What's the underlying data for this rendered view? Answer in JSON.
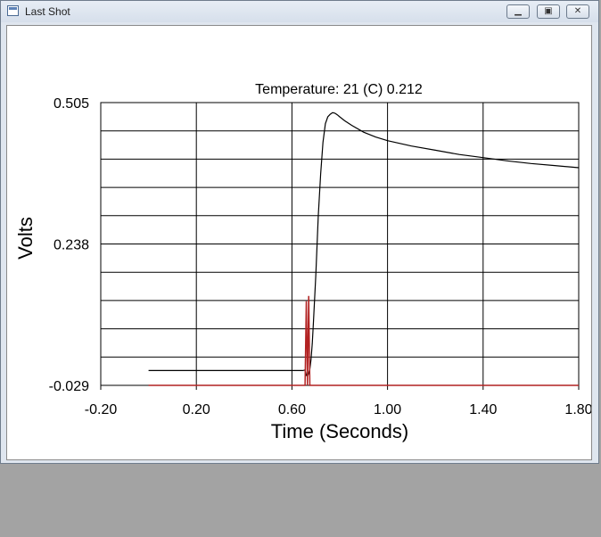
{
  "window": {
    "title": "Last Shot",
    "icon": "app-window-icon",
    "buttons": [
      "minimize-icon",
      "maximize-icon",
      "close-icon"
    ]
  },
  "chart_data": {
    "type": "line",
    "title": "Temperature: 21 (C) 0.212",
    "xlabel": "Time (Seconds)",
    "ylabel": "Volts",
    "xlim": [
      -0.2,
      1.8
    ],
    "ylim": [
      -0.029,
      0.505
    ],
    "x_ticks": [
      -0.2,
      0.2,
      0.6,
      1.0,
      1.4,
      1.8
    ],
    "x_tick_labels": [
      "-0.20",
      "0.20",
      "0.60",
      "1.00",
      "1.40",
      "1.80"
    ],
    "y_tick_labels": [
      "0.505",
      "0.238",
      "-0.029"
    ],
    "y_ticks": [
      0.505,
      0.238,
      -0.029
    ],
    "y_gridlines": 10,
    "grid": true,
    "series": [
      {
        "color": "#000000",
        "x": [
          0.0,
          0.645,
          0.655,
          0.66,
          0.665,
          0.67,
          0.675,
          0.68,
          0.685,
          0.69,
          0.7,
          0.71,
          0.72,
          0.73,
          0.74,
          0.75,
          0.76,
          0.77,
          0.78,
          0.79,
          0.8,
          0.82,
          0.85,
          0.9,
          0.95,
          1.0,
          1.1,
          1.2,
          1.3,
          1.4,
          1.5,
          1.6,
          1.7,
          1.8
        ],
        "y": [
          -0.001,
          -0.001,
          0.0,
          -0.01,
          -0.012,
          -0.006,
          0.002,
          0.02,
          0.05,
          0.09,
          0.18,
          0.29,
          0.37,
          0.43,
          0.465,
          0.478,
          0.483,
          0.486,
          0.485,
          0.482,
          0.478,
          0.471,
          0.462,
          0.449,
          0.44,
          0.433,
          0.423,
          0.415,
          0.407,
          0.401,
          0.395,
          0.39,
          0.386,
          0.382
        ]
      },
      {
        "color": "#b22222",
        "x": [
          0.0,
          0.655,
          0.66,
          0.665,
          0.67,
          0.675,
          1.8
        ],
        "y": [
          -0.029,
          -0.029,
          0.13,
          -0.029,
          0.14,
          -0.029,
          -0.029
        ]
      }
    ]
  }
}
